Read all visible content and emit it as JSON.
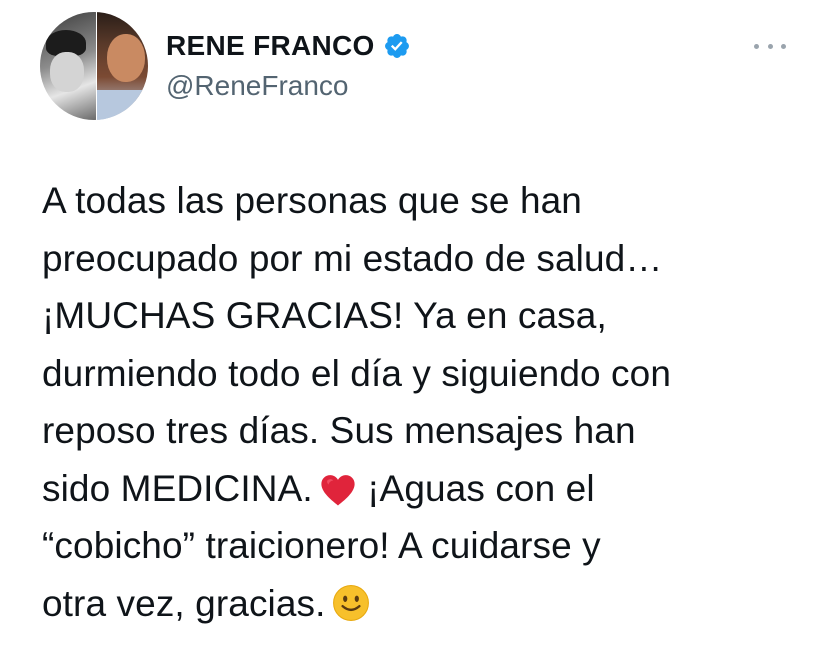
{
  "author": {
    "display_name": "RENE FRANCO",
    "handle": "@ReneFranco",
    "verified": true,
    "avatar_icon": "profile-photo"
  },
  "more_icon": "ellipsis-icon",
  "tweet": {
    "lines": [
      "A todas las personas que se han",
      "preocupado por mi estado de salud…",
      "¡MUCHAS GRACIAS! Ya en casa,",
      "durmiendo todo el día y siguiendo con",
      "reposo tres días. Sus mensajes han",
      "sido MEDICINA.",
      " ¡Aguas con el",
      "“cobicho” traicionero! A cuidarse y",
      "otra vez, gracias."
    ],
    "emojis": [
      "red-heart",
      "slightly-smiling-face"
    ]
  },
  "colors": {
    "text": "#0f1419",
    "secondary_text": "#536471",
    "verified_badge": "#1d9bf0",
    "heart": "#e0243b",
    "smile": "#f7c02b"
  }
}
